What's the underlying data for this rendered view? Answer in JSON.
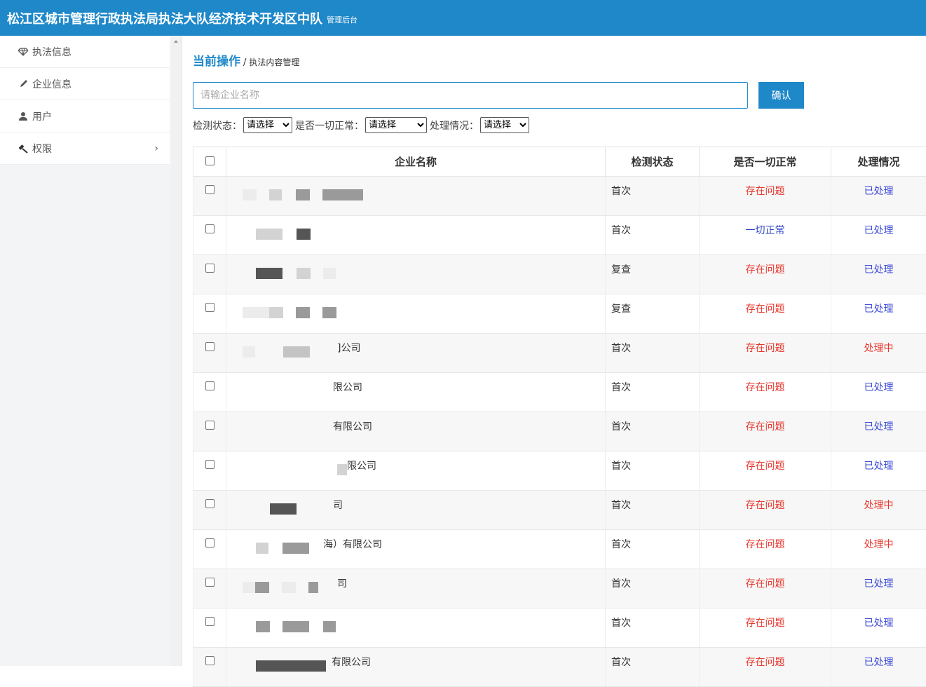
{
  "header": {
    "title": "松江区城市管理行政执法局执法大队经济技术开发区中队",
    "subtitle": "管理后台"
  },
  "sidebar": {
    "items": [
      {
        "label": "执法信息",
        "icon": "diamond-icon"
      },
      {
        "label": "企业信息",
        "icon": "pencil-icon"
      },
      {
        "label": "用户",
        "icon": "user-icon"
      },
      {
        "label": "权限",
        "icon": "gavel-icon",
        "arrow": "›"
      }
    ]
  },
  "breadcrumb": {
    "current": "当前操作",
    "separator": "/",
    "path": "执法内容管理"
  },
  "search": {
    "placeholder": "请输企业名称",
    "button": "确认"
  },
  "filters": [
    {
      "label": "检测状态：",
      "selected": "请选择"
    },
    {
      "label": "是否一切正常：",
      "selected": "请选择"
    },
    {
      "label": "处理情况：",
      "selected": "请选择"
    }
  ],
  "table": {
    "columns": [
      "企业名称",
      "检测状态",
      "是否一切正常",
      "处理情况"
    ],
    "rows": [
      {
        "name": "",
        "status": "首次",
        "normal": "存在问题",
        "handle": "已处理"
      },
      {
        "name": "",
        "status": "首次",
        "normal": "一切正常",
        "handle": "已处理"
      },
      {
        "name": "",
        "status": "复查",
        "normal": "存在问题",
        "handle": "已处理"
      },
      {
        "name": "",
        "status": "复查",
        "normal": "存在问题",
        "handle": "已处理"
      },
      {
        "name": "]公司",
        "status": "首次",
        "normal": "存在问题",
        "handle": "处理中"
      },
      {
        "name": "限公司",
        "status": "首次",
        "normal": "存在问题",
        "handle": "已处理"
      },
      {
        "name": "有限公司",
        "status": "首次",
        "normal": "存在问题",
        "handle": "已处理"
      },
      {
        "name": "限公司",
        "status": "首次",
        "normal": "存在问题",
        "handle": "已处理"
      },
      {
        "name": "司",
        "status": "首次",
        "normal": "存在问题",
        "handle": "处理中"
      },
      {
        "name": "海）有限公司",
        "status": "首次",
        "normal": "存在问题",
        "handle": "处理中"
      },
      {
        "name": "司",
        "status": "首次",
        "normal": "存在问题",
        "handle": "已处理"
      },
      {
        "name": "",
        "status": "首次",
        "normal": "存在问题",
        "handle": "已处理"
      },
      {
        "name": "有限公司",
        "status": "首次",
        "normal": "存在问题",
        "handle": "已处理"
      }
    ]
  },
  "colors": {
    "accent": "#1e88c9",
    "problem": "#e8382f",
    "done": "#3b4ad6"
  }
}
